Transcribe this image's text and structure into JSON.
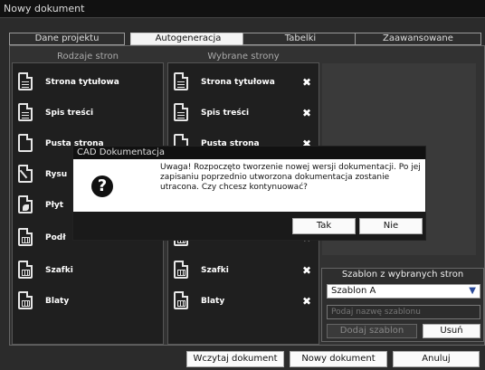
{
  "window": {
    "title": "Nowy dokument"
  },
  "tabs": [
    {
      "label": "Dane projektu"
    },
    {
      "label": "Autogeneracja",
      "active": true
    },
    {
      "label": "Tabelki"
    },
    {
      "label": "Zaawansowane"
    }
  ],
  "left_panel": {
    "header": "Rodzaje stron",
    "items": [
      {
        "label": "Strona tytułowa",
        "icon": "text-document-icon"
      },
      {
        "label": "Spis treści",
        "icon": "text-document-icon"
      },
      {
        "label": "Pusta strona",
        "icon": "blank-document-icon"
      },
      {
        "label": "Rysu",
        "icon": "drawing-document-icon"
      },
      {
        "label": "Płyt",
        "icon": "tile-document-icon"
      },
      {
        "label": "Podł",
        "icon": "table-document-icon"
      },
      {
        "label": "Szafki",
        "icon": "table-document-icon"
      },
      {
        "label": "Blaty",
        "icon": "table-document-icon"
      }
    ]
  },
  "middle_panel": {
    "header": "Wybrane strony",
    "items": [
      {
        "label": "Strona tytułowa",
        "icon": "text-document-icon"
      },
      {
        "label": "Spis treści",
        "icon": "text-document-icon"
      },
      {
        "label": "Pusta strona",
        "icon": "blank-document-icon"
      },
      {
        "label": "",
        "icon": "table-document-icon"
      },
      {
        "label": "Szafki",
        "icon": "table-document-icon"
      },
      {
        "label": "Blaty",
        "icon": "table-document-icon"
      }
    ],
    "remove_glyph": "✖"
  },
  "template_panel": {
    "title": "Szablon z wybranych stron",
    "selected": "Szablon A",
    "name_placeholder": "Podaj nazwę szablonu",
    "add_label": "Dodaj szablon",
    "remove_label": "Usuń"
  },
  "footer": {
    "load_label": "Wczytaj dokument",
    "new_label": "Nowy dokument",
    "cancel_label": "Anuluj"
  },
  "dialog": {
    "title": "CAD Dokumentacja",
    "message": "Uwaga! Rozpoczęto tworzenie nowej wersji dokumentacji. Po jej zapisaniu poprzednio utworzona dokumentacja zostanie utracona. Czy chcesz kontynuować?",
    "yes_label": "Tak",
    "no_label": "Nie",
    "icon": "question-icon"
  }
}
